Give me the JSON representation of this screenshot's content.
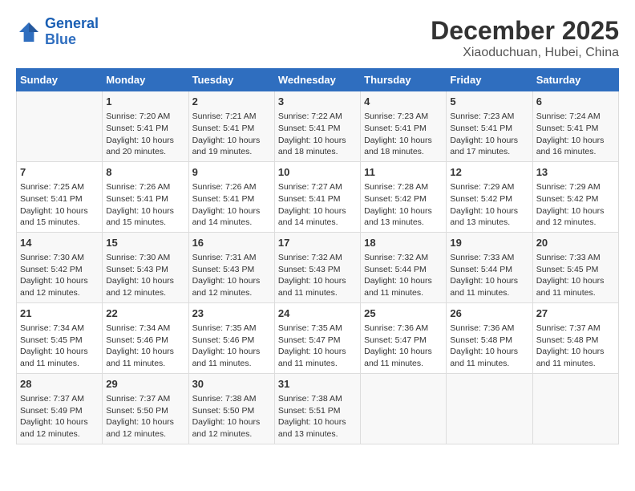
{
  "header": {
    "logo_line1": "General",
    "logo_line2": "Blue",
    "month_year": "December 2025",
    "location": "Xiaoduchuan, Hubei, China"
  },
  "days_of_week": [
    "Sunday",
    "Monday",
    "Tuesday",
    "Wednesday",
    "Thursday",
    "Friday",
    "Saturday"
  ],
  "weeks": [
    [
      {
        "day": "",
        "info": ""
      },
      {
        "day": "1",
        "info": "Sunrise: 7:20 AM\nSunset: 5:41 PM\nDaylight: 10 hours\nand 20 minutes."
      },
      {
        "day": "2",
        "info": "Sunrise: 7:21 AM\nSunset: 5:41 PM\nDaylight: 10 hours\nand 19 minutes."
      },
      {
        "day": "3",
        "info": "Sunrise: 7:22 AM\nSunset: 5:41 PM\nDaylight: 10 hours\nand 18 minutes."
      },
      {
        "day": "4",
        "info": "Sunrise: 7:23 AM\nSunset: 5:41 PM\nDaylight: 10 hours\nand 18 minutes."
      },
      {
        "day": "5",
        "info": "Sunrise: 7:23 AM\nSunset: 5:41 PM\nDaylight: 10 hours\nand 17 minutes."
      },
      {
        "day": "6",
        "info": "Sunrise: 7:24 AM\nSunset: 5:41 PM\nDaylight: 10 hours\nand 16 minutes."
      }
    ],
    [
      {
        "day": "7",
        "info": "Sunrise: 7:25 AM\nSunset: 5:41 PM\nDaylight: 10 hours\nand 15 minutes."
      },
      {
        "day": "8",
        "info": "Sunrise: 7:26 AM\nSunset: 5:41 PM\nDaylight: 10 hours\nand 15 minutes."
      },
      {
        "day": "9",
        "info": "Sunrise: 7:26 AM\nSunset: 5:41 PM\nDaylight: 10 hours\nand 14 minutes."
      },
      {
        "day": "10",
        "info": "Sunrise: 7:27 AM\nSunset: 5:41 PM\nDaylight: 10 hours\nand 14 minutes."
      },
      {
        "day": "11",
        "info": "Sunrise: 7:28 AM\nSunset: 5:42 PM\nDaylight: 10 hours\nand 13 minutes."
      },
      {
        "day": "12",
        "info": "Sunrise: 7:29 AM\nSunset: 5:42 PM\nDaylight: 10 hours\nand 13 minutes."
      },
      {
        "day": "13",
        "info": "Sunrise: 7:29 AM\nSunset: 5:42 PM\nDaylight: 10 hours\nand 12 minutes."
      }
    ],
    [
      {
        "day": "14",
        "info": "Sunrise: 7:30 AM\nSunset: 5:42 PM\nDaylight: 10 hours\nand 12 minutes."
      },
      {
        "day": "15",
        "info": "Sunrise: 7:30 AM\nSunset: 5:43 PM\nDaylight: 10 hours\nand 12 minutes."
      },
      {
        "day": "16",
        "info": "Sunrise: 7:31 AM\nSunset: 5:43 PM\nDaylight: 10 hours\nand 12 minutes."
      },
      {
        "day": "17",
        "info": "Sunrise: 7:32 AM\nSunset: 5:43 PM\nDaylight: 10 hours\nand 11 minutes."
      },
      {
        "day": "18",
        "info": "Sunrise: 7:32 AM\nSunset: 5:44 PM\nDaylight: 10 hours\nand 11 minutes."
      },
      {
        "day": "19",
        "info": "Sunrise: 7:33 AM\nSunset: 5:44 PM\nDaylight: 10 hours\nand 11 minutes."
      },
      {
        "day": "20",
        "info": "Sunrise: 7:33 AM\nSunset: 5:45 PM\nDaylight: 10 hours\nand 11 minutes."
      }
    ],
    [
      {
        "day": "21",
        "info": "Sunrise: 7:34 AM\nSunset: 5:45 PM\nDaylight: 10 hours\nand 11 minutes."
      },
      {
        "day": "22",
        "info": "Sunrise: 7:34 AM\nSunset: 5:46 PM\nDaylight: 10 hours\nand 11 minutes."
      },
      {
        "day": "23",
        "info": "Sunrise: 7:35 AM\nSunset: 5:46 PM\nDaylight: 10 hours\nand 11 minutes."
      },
      {
        "day": "24",
        "info": "Sunrise: 7:35 AM\nSunset: 5:47 PM\nDaylight: 10 hours\nand 11 minutes."
      },
      {
        "day": "25",
        "info": "Sunrise: 7:36 AM\nSunset: 5:47 PM\nDaylight: 10 hours\nand 11 minutes."
      },
      {
        "day": "26",
        "info": "Sunrise: 7:36 AM\nSunset: 5:48 PM\nDaylight: 10 hours\nand 11 minutes."
      },
      {
        "day": "27",
        "info": "Sunrise: 7:37 AM\nSunset: 5:48 PM\nDaylight: 10 hours\nand 11 minutes."
      }
    ],
    [
      {
        "day": "28",
        "info": "Sunrise: 7:37 AM\nSunset: 5:49 PM\nDaylight: 10 hours\nand 12 minutes."
      },
      {
        "day": "29",
        "info": "Sunrise: 7:37 AM\nSunset: 5:50 PM\nDaylight: 10 hours\nand 12 minutes."
      },
      {
        "day": "30",
        "info": "Sunrise: 7:38 AM\nSunset: 5:50 PM\nDaylight: 10 hours\nand 12 minutes."
      },
      {
        "day": "31",
        "info": "Sunrise: 7:38 AM\nSunset: 5:51 PM\nDaylight: 10 hours\nand 13 minutes."
      },
      {
        "day": "",
        "info": ""
      },
      {
        "day": "",
        "info": ""
      },
      {
        "day": "",
        "info": ""
      }
    ]
  ]
}
